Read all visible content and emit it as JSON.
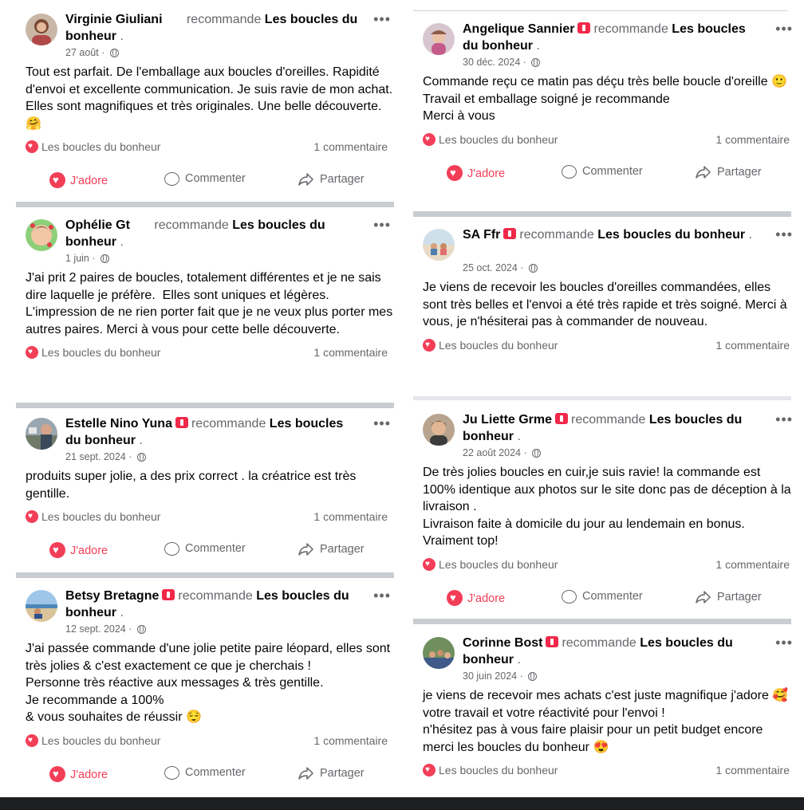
{
  "page_name": "Les boucles du bonheur",
  "recommends": "recommande",
  "page_title_prefix": "Les boucles",
  "stats_comments": "1 commentaire",
  "actions": {
    "love": "J'adore",
    "comment": "Commenter",
    "share": "Partager"
  },
  "posts": [
    {
      "author": "Virginie Giuliani",
      "page_label": "Les boucles du bonheur",
      "date": "27 août",
      "body": "Tout est parfait. De l'emballage aux boucles d'oreilles. Rapidité d'envoi et excellente communication. Je suis ravie de mon achat. Elles sont magnifiques et très originales. Une belle découverte. 🤗",
      "stats_page": "Les boucles du bonheur",
      "comments": "1 commentaire"
    },
    {
      "author": "Ophélie Gt",
      "page_label": "Les boucles du bonheur",
      "date": "1 juin",
      "body": "J'ai prit 2 paires de boucles, totalement différentes et je ne sais dire laquelle je préfère.  Elles sont uniques et légères. L'impression de ne rien porter fait que je ne veux plus porter mes autres paires. Merci à vous pour cette belle découverte.",
      "stats_page": "Les boucles du bonheur",
      "comments": "1 commentaire"
    },
    {
      "author": "Estelle Nino Yuna",
      "page_label": "Les boucles du bonheur",
      "date": "21 sept. 2024",
      "body": "produits super jolie, a des prix correct . la créatrice est très gentille.",
      "stats_page": "Les boucles du bonheur",
      "comments": "1 commentaire"
    },
    {
      "author": "Betsy Bretagne",
      "page_label": "Les boucles du bonheur",
      "date": "12 sept. 2024",
      "body": "J'ai passée commande d'une jolie petite paire léopard, elles sont très jolies & c'est exactement ce que je cherchais !\nPersonne très réactive aux messages & très gentille.\nJe recommande a 100%\n& vous souhaites de réussir 😌",
      "stats_page": "Les boucles du bonheur",
      "comments": "1 commentaire"
    },
    {
      "author": "Angelique Sannier",
      "page_label": "Les boucles du bonheur",
      "date": "30 déc. 2024",
      "body": "Commande reçu ce matin pas déçu très belle boucle d'oreille 🙂\nTravail et emballage soigné je recommande\nMerci à vous",
      "stats_page": "Les boucles du bonheur",
      "comments": "1 commentaire"
    },
    {
      "author": "SA Ffr",
      "page_label": "Les boucles du bonheur",
      "date": "25 oct. 2024",
      "body": "Je viens de recevoir les boucles d'oreilles commandées, elles sont très belles et l'envoi a été très rapide et très soigné. Merci à vous, je n'hésiterai pas à commander de nouveau.",
      "stats_page": "Les boucles du bonheur",
      "comments": "1 commentaire"
    },
    {
      "author": "Ju Liette Grme",
      "page_label": "Les boucles du bonheur",
      "date": "22 août 2024",
      "body": "De très jolies boucles en cuir,je suis ravie! la commande est 100% identique aux photos sur le site donc pas de déception à la livraison .\nLivraison faite à domicile du jour au lendemain en bonus.\nVraiment top!",
      "stats_page": "Les boucles du bonheur",
      "comments": "1 commentaire"
    },
    {
      "author": "Corinne Bost",
      "page_label": "Les boucles du bonheur",
      "date": "30 juin 2024",
      "body": "je viens de recevoir mes achats c'est juste magnifique j'adore 🥰 votre travail et votre réactivité pour l'envoi !\nn'hésitez pas à vous faire plaisir pour un petit budget encore merci les boucles du bonheur 😍",
      "stats_page": "Les boucles du bonheur",
      "comments": "1 commentaire"
    }
  ],
  "colors": {
    "love": "#f33e58",
    "secondary_text": "#65676b",
    "separator": "#c9ccd1"
  }
}
